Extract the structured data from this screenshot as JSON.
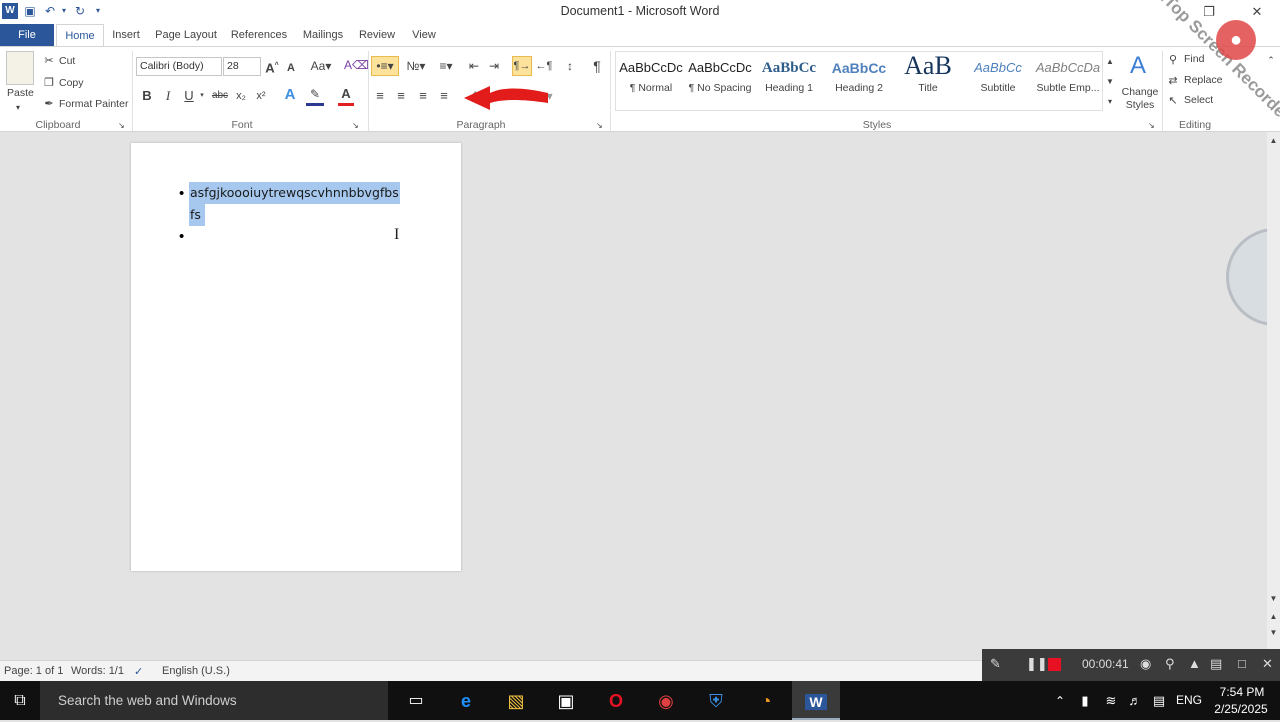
{
  "window": {
    "title": "Document1 - Microsoft Word"
  },
  "tabs": [
    "File",
    "Home",
    "Insert",
    "Page Layout",
    "References",
    "Mailings",
    "Review",
    "View"
  ],
  "clipboard": {
    "paste": "Paste",
    "cut": "Cut",
    "copy": "Copy",
    "format_painter": "Format Painter",
    "label": "Clipboard"
  },
  "font": {
    "name": "Calibri (Body)",
    "size": "28",
    "label": "Font",
    "bold": "B",
    "italic": "I",
    "underline": "U",
    "strike": "abc",
    "sub": "x₂",
    "sup": "x²"
  },
  "paragraph": {
    "label": "Paragraph",
    "pilcrow": "¶"
  },
  "styles": {
    "label": "Styles",
    "items": [
      {
        "preview": "AaBbCcDc",
        "name": "¶ Normal"
      },
      {
        "preview": "AaBbCcDc",
        "name": "¶ No Spacing"
      },
      {
        "preview": "AaBbCc",
        "name": "Heading 1"
      },
      {
        "preview": "AaBbCc",
        "name": "Heading 2"
      },
      {
        "preview": "AaB",
        "name": "Title"
      },
      {
        "preview": "AaBbCc",
        "name": "Subtitle"
      },
      {
        "preview": "AaBbCcDa",
        "name": "Subtle Emp..."
      }
    ],
    "change_styles": "Change Styles"
  },
  "editing": {
    "find": "Find",
    "replace": "Replace",
    "select": "Select",
    "label": "Editing"
  },
  "document": {
    "bullet1_line1": "asfgjkoooiuytrewqscvhnnbbvgfbs",
    "bullet1_line2": "fs",
    "bullet2": ""
  },
  "status": {
    "page": "Page: 1 of 1",
    "words": "Words: 1/1",
    "language": "English (U.S.)"
  },
  "recorder": {
    "time": "00:00:41",
    "watermark": "iTop Screen Recorder"
  },
  "taskbar": {
    "search": "Search the web and Windows",
    "lang": "ENG",
    "time": "7:54 PM",
    "date": "2/25/2025"
  },
  "colors": {
    "brand": "#2b579a",
    "selection": "#a6c8ee",
    "recorder_stop": "#e81123"
  }
}
